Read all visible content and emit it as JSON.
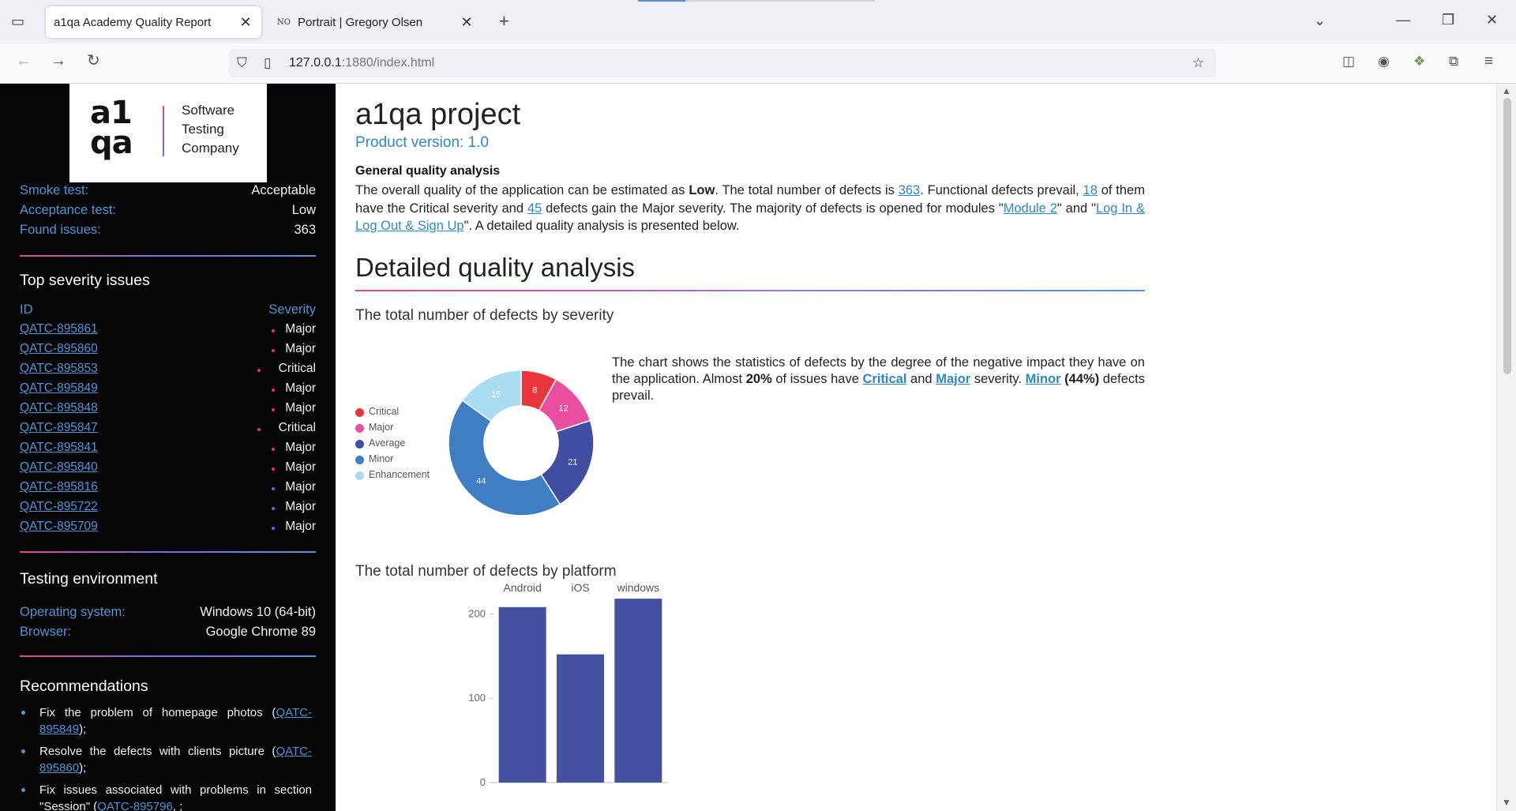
{
  "browser": {
    "tabs": [
      {
        "title": "a1qa Academy Quality Report",
        "active": true
      },
      {
        "title": "Portrait | Gregory Olsen",
        "favicon": "NO",
        "active": false
      }
    ],
    "url_host": "127.0.0.1",
    "url_path": ":1880/index.html"
  },
  "sidebar": {
    "logo": {
      "mark_line1": "a1",
      "mark_line2": "qa",
      "text": [
        "Software",
        "Testing",
        "Company"
      ]
    },
    "summary": [
      {
        "key": "Smoke test:",
        "value": "Acceptable"
      },
      {
        "key": "Acceptance test:",
        "value": "Low"
      },
      {
        "key": "Found issues:",
        "value": "363"
      }
    ],
    "top_severity": {
      "heading": "Top severity issues",
      "col_id": "ID",
      "col_severity": "Severity",
      "rows": [
        {
          "id": "QATC-895861",
          "severity": "Major",
          "dot": "#e03c3c"
        },
        {
          "id": "QATC-895860",
          "severity": "Major",
          "dot": "#e03c3c"
        },
        {
          "id": "QATC-895853",
          "severity": "Critical",
          "dot": "#e03c3c"
        },
        {
          "id": "QATC-895849",
          "severity": "Major",
          "dot": "#e03c3c"
        },
        {
          "id": "QATC-895848",
          "severity": "Major",
          "dot": "#e03c3c"
        },
        {
          "id": "QATC-895847",
          "severity": "Critical",
          "dot": "#e03c3c"
        },
        {
          "id": "QATC-895841",
          "severity": "Major",
          "dot": "#e03c3c"
        },
        {
          "id": "QATC-895840",
          "severity": "Major",
          "dot": "#e03c3c"
        },
        {
          "id": "QATC-895816",
          "severity": "Major",
          "dot": "#6b6bd6"
        },
        {
          "id": "QATC-895722",
          "severity": "Major",
          "dot": "#6b6bd6"
        },
        {
          "id": "QATC-895709",
          "severity": "Major",
          "dot": "#6b6bd6"
        }
      ]
    },
    "environment": {
      "heading": "Testing environment",
      "rows": [
        {
          "key": "Operating system:",
          "value": "Windows 10 (64-bit)"
        },
        {
          "key": "Browser:",
          "value": "Google Chrome 89"
        }
      ]
    },
    "recommendations": {
      "heading": "Recommendations",
      "items": [
        {
          "text": "Fix the problem of homepage photos (",
          "link": "QATC-895849",
          "suffix": ");"
        },
        {
          "text": "Resolve the defects with clients picture (",
          "link": "QATC-895860",
          "suffix": ");"
        },
        {
          "text": "Fix issues associated with problems in section \"Session\" (",
          "link": "QATC-895796",
          "suffix": ", ;"
        }
      ]
    }
  },
  "main": {
    "title": "a1qa project",
    "product_version": "Product version: 1.0",
    "general": {
      "heading": "General quality analysis",
      "p1": "The overall quality of the application can be estimated as ",
      "quality": "Low",
      "p2": ". The total number of defects is ",
      "total": "363",
      "p3": ". Functional defects prevail, ",
      "critical": "18",
      "p4": " of them have the Critical severity and ",
      "major": "45",
      "p5": " defects gain the Major severity. The majority of defects is opened for modules \"",
      "module1": "Module 2",
      "p6": "\" and \"",
      "module2": "Log In & Log Out & Sign Up",
      "p7": "\". A detailed quality analysis is presented below."
    },
    "detailed_title": "Detailed quality analysis",
    "severity_section": {
      "title": "The total number of defects by severity",
      "d1": "The chart shows the statistics of defects by the degree of the negative impact they have on the application. Almost ",
      "pct": "20%",
      "d2": " of issues have ",
      "crit": "Critical",
      "d3": " and ",
      "maj": "Major",
      "d4": " severity. ",
      "minor": "Minor",
      "minor_pct": "(44%)",
      "d5": " defects prevail."
    },
    "platform_section": {
      "title": "The total number of defects by platform"
    }
  },
  "chart_data": [
    {
      "type": "pie",
      "categories": [
        "Critical",
        "Major",
        "Average",
        "Minor",
        "Enhancement"
      ],
      "values": [
        8,
        12,
        21,
        44,
        15
      ],
      "colors": [
        "#e8363b",
        "#e94ea0",
        "#3f4ea3",
        "#3f7ec2",
        "#a9dcf0"
      ],
      "legend": "left"
    },
    {
      "type": "bar",
      "categories": [
        "Android",
        "iOS",
        "windows"
      ],
      "values": [
        208,
        152,
        218
      ],
      "ylim": [
        0,
        220
      ],
      "yticks": [
        0,
        100,
        200
      ],
      "color": "#4451a0"
    }
  ]
}
